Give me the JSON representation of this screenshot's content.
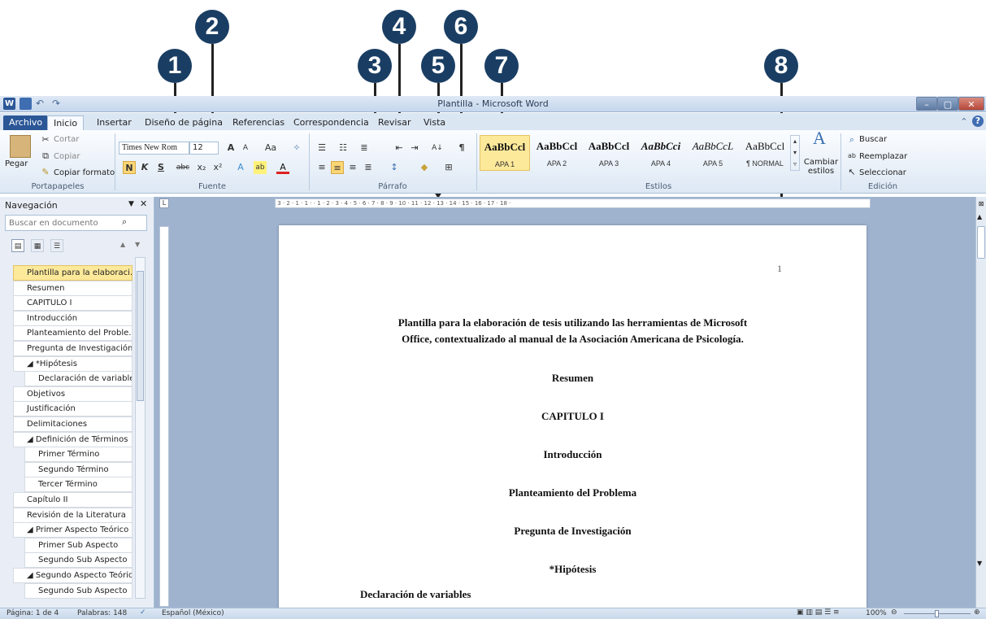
{
  "callouts": [
    "1",
    "2",
    "3",
    "4",
    "5",
    "6",
    "7",
    "8"
  ],
  "window": {
    "title": "Plantilla - Microsoft Word"
  },
  "tabs": [
    "Archivo",
    "Inicio",
    "Insertar",
    "Diseño de página",
    "Referencias",
    "Correspondencia",
    "Revisar",
    "Vista"
  ],
  "ribbon": {
    "clipboard": {
      "paste": "Pegar",
      "cut": "Cortar",
      "copy": "Copiar",
      "format_painter": "Copiar formato",
      "label": "Portapapeles"
    },
    "font": {
      "name": "Times New Rom",
      "size": "12",
      "bold": "N",
      "italic": "K",
      "underline": "S",
      "label": "Fuente"
    },
    "paragraph": {
      "label": "Párrafo"
    },
    "styles": {
      "items": [
        {
          "sample": "AaBbCcl",
          "name": "APA 1"
        },
        {
          "sample": "AaBbCcl",
          "name": "APA 2"
        },
        {
          "sample": "AaBbCcl",
          "name": "APA 3"
        },
        {
          "sample": "AaBbCci",
          "name": "APA 4"
        },
        {
          "sample": "AaBbCcL",
          "name": "APA 5"
        },
        {
          "sample": "AaBbCcl",
          "name": "¶ NORMAL"
        }
      ],
      "change": "Cambiar estilos",
      "label": "Estilos"
    },
    "editing": {
      "find": "Buscar",
      "replace": "Reemplazar",
      "select": "Seleccionar",
      "label": "Edición"
    }
  },
  "nav": {
    "title": "Navegación",
    "search_placeholder": "Buscar en documento",
    "items": [
      {
        "label": "Plantilla para la elaboraci...",
        "level": 1,
        "selected": true
      },
      {
        "label": "Resumen",
        "level": 1
      },
      {
        "label": "CAPITULO I",
        "level": 1
      },
      {
        "label": "Introducción",
        "level": 1
      },
      {
        "label": "Planteamiento del Proble...",
        "level": 1
      },
      {
        "label": "Pregunta de Investigación",
        "level": 1
      },
      {
        "label": "◢ *Hipótesis",
        "level": 1
      },
      {
        "label": "Declaración de variables",
        "level": 2
      },
      {
        "label": "Objetivos",
        "level": 1
      },
      {
        "label": "Justificación",
        "level": 1
      },
      {
        "label": "Delimitaciones",
        "level": 1
      },
      {
        "label": "◢ Definición de Términos",
        "level": 1
      },
      {
        "label": "Primer Término",
        "level": 2
      },
      {
        "label": "Segundo Término",
        "level": 2
      },
      {
        "label": "Tercer Término",
        "level": 2
      },
      {
        "label": "Capítulo II",
        "level": 1
      },
      {
        "label": "Revisión de la Literatura",
        "level": 1
      },
      {
        "label": "◢ Primer Aspecto Teórico",
        "level": 1
      },
      {
        "label": "Primer Sub Aspecto",
        "level": 2
      },
      {
        "label": "Segundo Sub Aspecto",
        "level": 2
      },
      {
        "label": "◢ Segundo Aspecto Teórico",
        "level": 1
      },
      {
        "label": "Segundo Sub Aspecto",
        "level": 2
      }
    ]
  },
  "document": {
    "page_number": "1",
    "title_line1": "Plantilla para la elaboración de tesis utilizando las herramientas de Microsoft",
    "title_line2": "Office, contextualizado al manual de la Asociación Americana de Psicología.",
    "headings": [
      "Resumen",
      "CAPITULO I",
      "Introducción",
      "Planteamiento del Problema",
      "Pregunta de Investigación",
      "*Hipótesis"
    ],
    "subheading": "Declaración de variables"
  },
  "status": {
    "page": "Página: 1 de 4",
    "words": "Palabras: 148",
    "language": "Español (México)",
    "zoom": "100%"
  }
}
